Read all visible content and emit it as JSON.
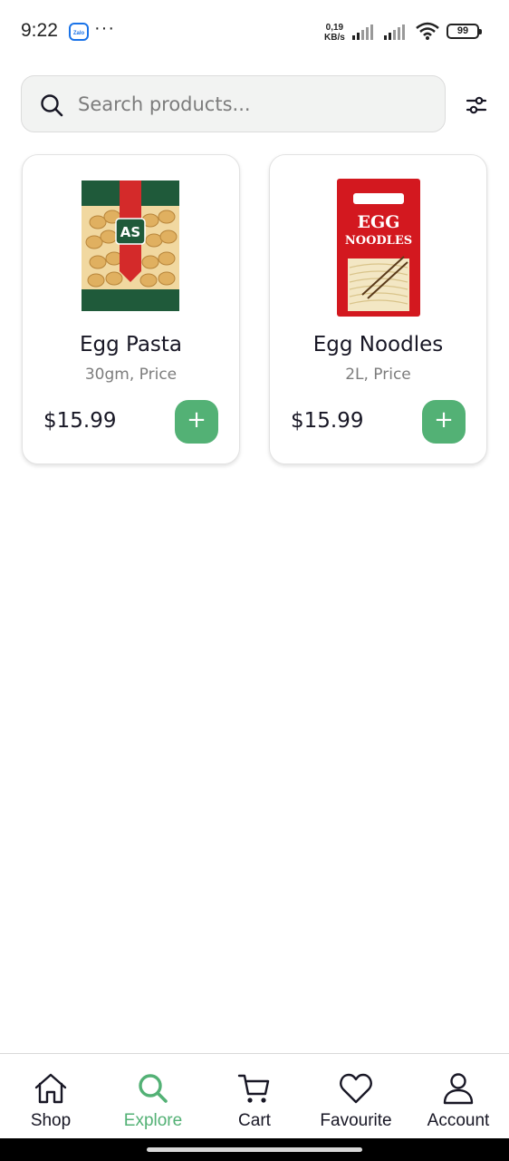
{
  "status_bar": {
    "time": "9:22",
    "dots": "···",
    "net_speed_value": "0,19",
    "net_speed_unit": "KB/s",
    "battery": "99",
    "icons": [
      "zalo-app-icon",
      "signal-icon",
      "signal-icon",
      "wifi-icon",
      "battery-icon"
    ]
  },
  "search": {
    "placeholder": "Search products...",
    "value": "",
    "icon": "search-icon",
    "filter_icon": "filter-sliders-icon"
  },
  "products": [
    {
      "name": "Egg Pasta",
      "subtitle": "30gm, Price",
      "price": "$15.99",
      "add_label": "+",
      "image_label": "AS"
    },
    {
      "name": "Egg Noodles",
      "subtitle": "2L, Price",
      "price": "$15.99",
      "add_label": "+",
      "image_label_top": "EGG",
      "image_label_bottom": "NOODLES"
    }
  ],
  "bottom_nav": {
    "active": "Explore",
    "items": [
      {
        "label": "Shop",
        "icon": "home-icon"
      },
      {
        "label": "Explore",
        "icon": "search-icon"
      },
      {
        "label": "Cart",
        "icon": "cart-icon"
      },
      {
        "label": "Favourite",
        "icon": "heart-icon"
      },
      {
        "label": "Account",
        "icon": "user-icon"
      }
    ]
  },
  "colors": {
    "accent": "#53b175",
    "text_primary": "#181725",
    "text_secondary": "#7c7c7c"
  }
}
